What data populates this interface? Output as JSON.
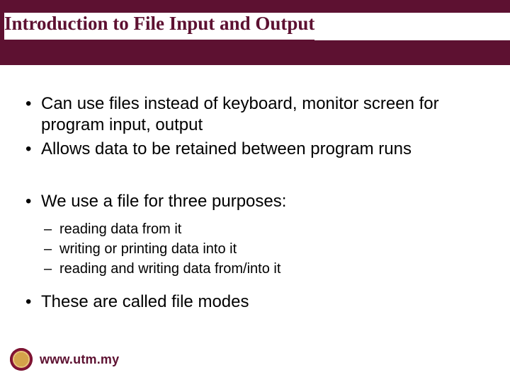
{
  "title": "Introduction to File Input and Output",
  "bullets": {
    "b1": "Can use files instead of keyboard, monitor screen for program input, output",
    "b2": "Allows data to be retained between program runs",
    "b3": "We use a file for three purposes:",
    "sub": {
      "s1": "reading data from it",
      "s2": "writing or printing data into it",
      "s3": "reading and writing data from/into it"
    },
    "b4": "These are called file modes"
  },
  "footer": {
    "url": "www.utm.my"
  }
}
